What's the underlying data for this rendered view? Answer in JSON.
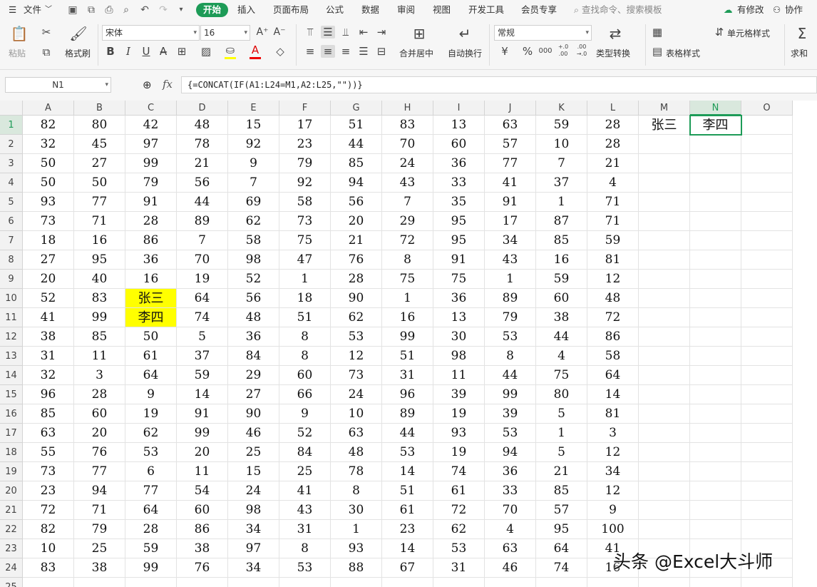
{
  "menu": {
    "file": "文件",
    "tabs": [
      "开始",
      "插入",
      "页面布局",
      "公式",
      "数据",
      "审阅",
      "视图",
      "开发工具",
      "会员专享"
    ],
    "search_placeholder": "查找命令、搜索模板",
    "right": [
      "有修改",
      "协作"
    ]
  },
  "ribbon": {
    "paste": "粘贴",
    "format_painter": "格式刷",
    "font_name": "宋体",
    "font_size": "16",
    "merge_center": "合并居中",
    "wrap_text": "自动换行",
    "number_format": "常规",
    "type_convert": "类型转换",
    "cell_style": "单元格样式",
    "table_style": "表格样式",
    "sum": "求和",
    "bold": "B",
    "italic": "I",
    "underline": "U",
    "font_color": "A",
    "currency": "¥",
    "percent": "%",
    "thousands": "000",
    "inc_decimal": "+.0 .00",
    "dec_decimal": ".00 →.0"
  },
  "formula_bar": {
    "name_box": "N1",
    "fx": "fx",
    "formula": "{=CONCAT(IF(A1:L24=M1,A2:L25,\"\"))}"
  },
  "columns": [
    "A",
    "B",
    "C",
    "D",
    "E",
    "F",
    "G",
    "H",
    "I",
    "J",
    "K",
    "L",
    "M",
    "N",
    "O"
  ],
  "selected_column": "N",
  "selected_row": "1",
  "rows": [
    {
      "n": "1",
      "v": [
        "82",
        "80",
        "42",
        "48",
        "15",
        "17",
        "51",
        "83",
        "13",
        "63",
        "59",
        "28",
        "张三",
        "李四",
        ""
      ]
    },
    {
      "n": "2",
      "v": [
        "32",
        "45",
        "97",
        "78",
        "92",
        "23",
        "44",
        "70",
        "60",
        "57",
        "10",
        "28",
        "",
        "",
        ""
      ]
    },
    {
      "n": "3",
      "v": [
        "50",
        "27",
        "99",
        "21",
        "9",
        "79",
        "85",
        "24",
        "36",
        "77",
        "7",
        "21",
        "",
        "",
        ""
      ]
    },
    {
      "n": "4",
      "v": [
        "50",
        "50",
        "79",
        "56",
        "7",
        "92",
        "94",
        "43",
        "33",
        "41",
        "37",
        "4",
        "",
        "",
        ""
      ]
    },
    {
      "n": "5",
      "v": [
        "93",
        "77",
        "91",
        "44",
        "69",
        "58",
        "56",
        "7",
        "35",
        "91",
        "1",
        "71",
        "",
        "",
        ""
      ]
    },
    {
      "n": "6",
      "v": [
        "73",
        "71",
        "28",
        "89",
        "62",
        "73",
        "20",
        "29",
        "95",
        "17",
        "87",
        "71",
        "",
        "",
        ""
      ]
    },
    {
      "n": "7",
      "v": [
        "18",
        "16",
        "86",
        "7",
        "58",
        "75",
        "21",
        "72",
        "95",
        "34",
        "85",
        "59",
        "",
        "",
        ""
      ]
    },
    {
      "n": "8",
      "v": [
        "27",
        "95",
        "36",
        "70",
        "98",
        "47",
        "76",
        "8",
        "91",
        "43",
        "16",
        "81",
        "",
        "",
        ""
      ]
    },
    {
      "n": "9",
      "v": [
        "20",
        "40",
        "16",
        "19",
        "52",
        "1",
        "28",
        "75",
        "75",
        "1",
        "59",
        "12",
        "",
        "",
        ""
      ]
    },
    {
      "n": "10",
      "v": [
        "52",
        "83",
        "张三",
        "64",
        "56",
        "18",
        "90",
        "1",
        "36",
        "89",
        "60",
        "48",
        "",
        "",
        ""
      ]
    },
    {
      "n": "11",
      "v": [
        "41",
        "99",
        "李四",
        "74",
        "48",
        "51",
        "62",
        "16",
        "13",
        "79",
        "38",
        "72",
        "",
        "",
        ""
      ]
    },
    {
      "n": "12",
      "v": [
        "38",
        "85",
        "50",
        "5",
        "36",
        "8",
        "53",
        "99",
        "30",
        "53",
        "44",
        "86",
        "",
        "",
        ""
      ]
    },
    {
      "n": "13",
      "v": [
        "31",
        "11",
        "61",
        "37",
        "84",
        "8",
        "12",
        "51",
        "98",
        "8",
        "4",
        "58",
        "",
        "",
        ""
      ]
    },
    {
      "n": "14",
      "v": [
        "32",
        "3",
        "64",
        "59",
        "29",
        "60",
        "73",
        "31",
        "11",
        "44",
        "75",
        "64",
        "",
        "",
        ""
      ]
    },
    {
      "n": "15",
      "v": [
        "96",
        "28",
        "9",
        "14",
        "27",
        "66",
        "24",
        "96",
        "39",
        "99",
        "80",
        "14",
        "",
        "",
        ""
      ]
    },
    {
      "n": "16",
      "v": [
        "85",
        "60",
        "19",
        "91",
        "90",
        "9",
        "10",
        "89",
        "19",
        "39",
        "5",
        "81",
        "",
        "",
        ""
      ]
    },
    {
      "n": "17",
      "v": [
        "63",
        "20",
        "62",
        "99",
        "46",
        "52",
        "63",
        "44",
        "93",
        "53",
        "1",
        "3",
        "",
        "",
        ""
      ]
    },
    {
      "n": "18",
      "v": [
        "55",
        "76",
        "53",
        "20",
        "25",
        "84",
        "48",
        "53",
        "19",
        "94",
        "5",
        "12",
        "",
        "",
        ""
      ]
    },
    {
      "n": "19",
      "v": [
        "73",
        "77",
        "6",
        "11",
        "15",
        "25",
        "78",
        "14",
        "74",
        "36",
        "21",
        "34",
        "",
        "",
        ""
      ]
    },
    {
      "n": "20",
      "v": [
        "23",
        "94",
        "77",
        "54",
        "24",
        "41",
        "8",
        "51",
        "61",
        "33",
        "85",
        "12",
        "",
        "",
        ""
      ]
    },
    {
      "n": "21",
      "v": [
        "72",
        "71",
        "64",
        "60",
        "98",
        "43",
        "30",
        "61",
        "72",
        "70",
        "57",
        "9",
        "",
        "",
        ""
      ]
    },
    {
      "n": "22",
      "v": [
        "82",
        "79",
        "28",
        "86",
        "34",
        "31",
        "1",
        "23",
        "62",
        "4",
        "95",
        "100",
        "",
        "",
        ""
      ]
    },
    {
      "n": "23",
      "v": [
        "10",
        "25",
        "59",
        "38",
        "97",
        "8",
        "93",
        "14",
        "53",
        "63",
        "64",
        "41",
        "",
        "",
        ""
      ]
    },
    {
      "n": "24",
      "v": [
        "83",
        "38",
        "99",
        "76",
        "34",
        "53",
        "88",
        "67",
        "31",
        "46",
        "74",
        "16",
        "",
        "",
        ""
      ]
    },
    {
      "n": "25",
      "v": [
        "",
        "",
        "",
        "",
        "",
        "",
        "",
        "",
        "",
        "",
        "",
        "",
        "",
        "",
        ""
      ]
    }
  ],
  "highlight_color": "#ffff00",
  "accent_color": "#1d9b57",
  "watermark": "头条 @Excel大斗师"
}
